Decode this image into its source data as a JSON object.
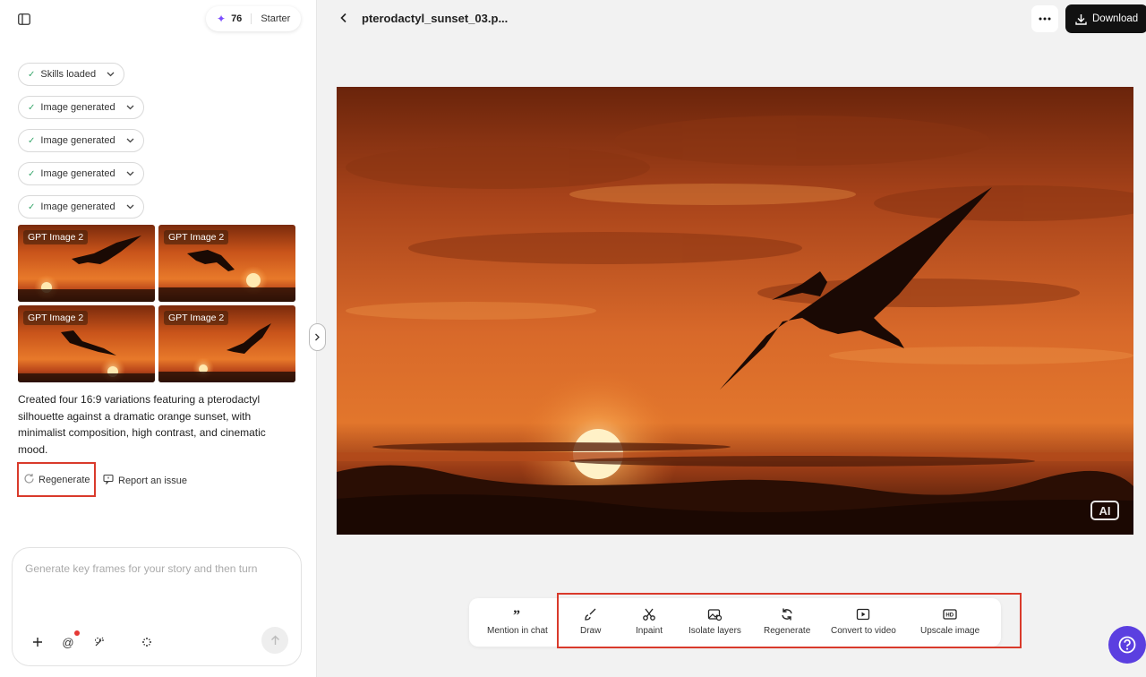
{
  "header": {
    "credits": "76",
    "plan": "Starter",
    "file_title": "pterodactyl_sunset_03.p...",
    "download_label": "Download"
  },
  "steps": [
    {
      "label": "Skills loaded"
    },
    {
      "label": "Image generated"
    },
    {
      "label": "Image generated"
    },
    {
      "label": "Image generated"
    },
    {
      "label": "Image generated"
    }
  ],
  "thumbnails": [
    {
      "tag": "GPT Image 2"
    },
    {
      "tag": "GPT Image 2"
    },
    {
      "tag": "GPT Image 2"
    },
    {
      "tag": "GPT Image 2"
    }
  ],
  "summary": "Created four 16:9 variations featuring a pterodactyl silhouette against a dramatic orange sunset, with minimalist composition, high contrast, and cinematic mood.",
  "actions": {
    "regenerate": "Regenerate",
    "report": "Report an issue"
  },
  "composer": {
    "placeholder": "Generate key frames for your story and then turn"
  },
  "main": {
    "ai_badge": "AI"
  },
  "toolbar": {
    "mention": "Mention in chat",
    "draw": "Draw",
    "inpaint": "Inpaint",
    "isolate": "Isolate layers",
    "regenerate": "Regenerate",
    "convert": "Convert to video",
    "upscale": "Upscale image"
  },
  "colors": {
    "accent": "#5b3fe0",
    "highlight": "#d93a2b",
    "sunset": "#e8792a"
  }
}
